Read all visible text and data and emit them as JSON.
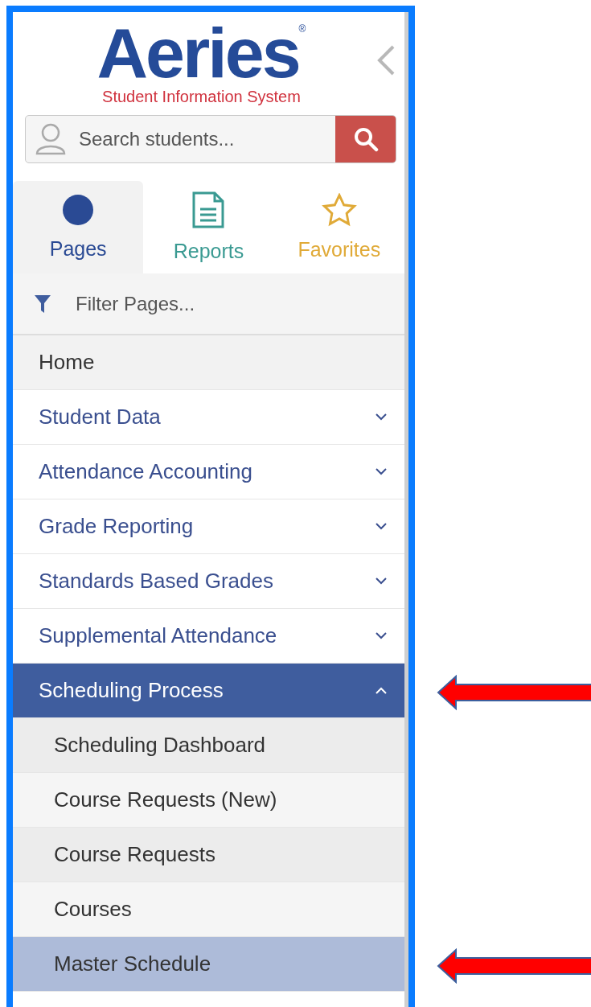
{
  "logo": {
    "name": "Aeries",
    "mark": "®",
    "tagline": "Student Information System"
  },
  "search": {
    "placeholder": "Search students..."
  },
  "tabs": [
    {
      "label": "Pages",
      "kind": "pages",
      "color": "#2a4a94",
      "selected": true
    },
    {
      "label": "Reports",
      "kind": "reports",
      "color": "#3a9a92",
      "selected": false
    },
    {
      "label": "Favorites",
      "kind": "favorites",
      "color": "#e0aa38",
      "selected": false
    }
  ],
  "filter": {
    "placeholder": "Filter Pages..."
  },
  "menu": [
    {
      "label": "Home",
      "kind": "link"
    },
    {
      "label": "Student Data",
      "kind": "section",
      "expanded": false
    },
    {
      "label": "Attendance Accounting",
      "kind": "section",
      "expanded": false
    },
    {
      "label": "Grade Reporting",
      "kind": "section",
      "expanded": false
    },
    {
      "label": "Standards Based Grades",
      "kind": "section",
      "expanded": false
    },
    {
      "label": "Supplemental Attendance",
      "kind": "section",
      "expanded": false
    },
    {
      "label": "Scheduling Process",
      "kind": "section",
      "expanded": true,
      "arrow": true,
      "children": [
        {
          "label": "Scheduling Dashboard",
          "selected": false
        },
        {
          "label": "Course Requests (New)",
          "selected": false
        },
        {
          "label": "Course Requests",
          "selected": false
        },
        {
          "label": "Courses",
          "selected": false
        },
        {
          "label": "Master Schedule",
          "selected": true,
          "arrow": true
        }
      ]
    }
  ]
}
